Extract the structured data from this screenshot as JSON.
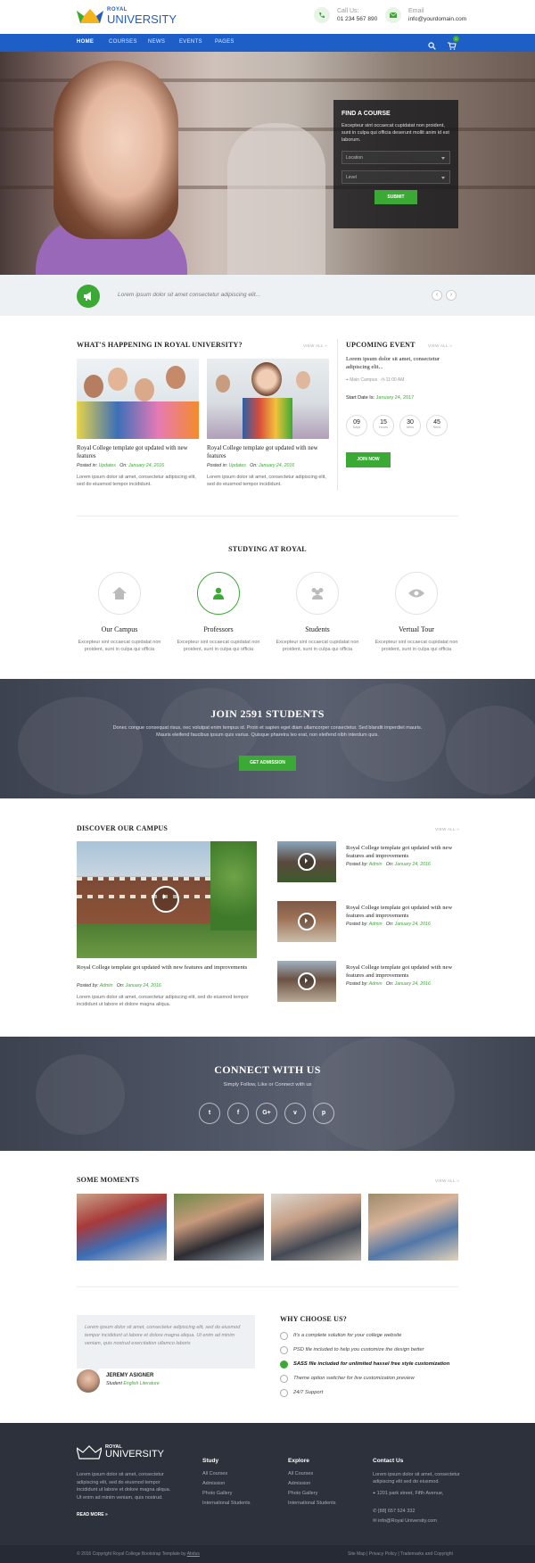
{
  "brand": {
    "line1": "ROYAL",
    "line2": "UNIVERSITY"
  },
  "contact": {
    "call_label": "Call Us:",
    "call_value": "01 234 567 890",
    "email_label": "Email",
    "email_value": "info@yourdomain.com"
  },
  "nav": {
    "items": [
      "HOME",
      "COURSES",
      "NEWS",
      "EVENTS",
      "PAGES"
    ],
    "cart_count": "0"
  },
  "course_finder": {
    "title": "FIND A COURSE",
    "text": "Excepteur sint occaecat cupidatat non proident, sunt in culpa qui officia deserunt mollit anim id est laborum.",
    "location_placeholder": "Location",
    "level_placeholder": "Level",
    "submit": "SUBMIT"
  },
  "ticker": {
    "text": "Lorem ipsum dolor sit amet consectetur adipiscing elit..."
  },
  "happening": {
    "title": "WHAT'S HAPPENING IN ROYAL UNIVERSITY?",
    "view_all": "VIEW ALL »",
    "cards": [
      {
        "title": "Royal College template got updated with new features",
        "posted_label": "Posted in:",
        "category": "Updates",
        "on_label": "On:",
        "date": "January 24, 2016",
        "desc": "Lorem ipsum dolor sit amet, consectetur adipiscing elit, sed do eiusmod tempor incididunt."
      },
      {
        "title": "Royal College template got updated with new features",
        "posted_label": "Posted in:",
        "category": "Updates",
        "on_label": "On:",
        "date": "January 24, 2016",
        "desc": "Lorem ipsum dolor sit amet, consectetur adipiscing elit, sed do eiusmod tempor incididunt."
      }
    ]
  },
  "event": {
    "title": "UPCOMING EVENT",
    "view_all": "VIEW ALL »",
    "name": "Lorem ipsum dolor sit amet, consectetur adipiscing elit...",
    "place": "Main Campus",
    "time": "11:00 AM",
    "start_label": "Start Date Is:",
    "start_date": "January 24, 2017",
    "countdown": [
      {
        "n": "09",
        "u": "Days"
      },
      {
        "n": "15",
        "u": "Hours"
      },
      {
        "n": "30",
        "u": "Mins"
      },
      {
        "n": "45",
        "u": "Secs"
      }
    ],
    "join": "JOIN NOW"
  },
  "studying": {
    "title": "STUDYING AT ROYAL",
    "items": [
      {
        "title": "Our Campus",
        "desc": "Excepteur sint occaecat cupidatat non proident, sunt in culpa qui officia"
      },
      {
        "title": "Professors",
        "desc": "Excepteur sint occaecat cupidatat non proident, sunt in culpa qui officia"
      },
      {
        "title": "Students",
        "desc": "Excepteur sint occaecat cupidatat non proident, sunt in culpa qui officia"
      },
      {
        "title": "Vertual Tour",
        "desc": "Excepteur sint occaecat cupidatat non proident, sunt in culpa qui officia"
      }
    ]
  },
  "join": {
    "title": "JOIN 2591 STUDENTS",
    "text": "Donec congue consequat risus, nec volutpat enim tempus id. Proin et sapien eget diam ullamcorper consectetur. Sed blandit imperdiet mauris. Mauris eleifend faucibus ipsum quis varius. Quisque pharetra leo erat, non eleifend nibh interdum quis.",
    "button": "GET ADMISSION"
  },
  "campus": {
    "title": "DISCOVER OUR CAMPUS",
    "view_all": "VIEW ALL »",
    "main": {
      "title": "Royal College template got updated with new features and improvements",
      "posted_label": "Posted by:",
      "author": "Admin",
      "on_label": "On:",
      "date": "January 24, 2016",
      "desc": "Lorem ipsum dolor sit amet, consectetur adipiscing elit, sed do eiusmod tempor incididunt ut labore et dolore magna aliqua."
    },
    "side": [
      {
        "title": "Royal College template got updated with new features and improvements",
        "posted_label": "Posted by:",
        "author": "Admin",
        "on_label": "On:",
        "date": "January 24, 2016"
      },
      {
        "title": "Royal College template got updated with new features and improvements",
        "posted_label": "Posted by:",
        "author": "Admin",
        "on_label": "On:",
        "date": "January 24, 2016"
      },
      {
        "title": "Royal College template got updated with new features and improvements",
        "posted_label": "Posted by:",
        "author": "Admin",
        "on_label": "On:",
        "date": "January 24, 2016"
      }
    ]
  },
  "connect": {
    "title": "CONNECT WITH US",
    "subtitle": "Simply Follow, Like or Connect with us",
    "icons": [
      "twitter-icon",
      "facebook-icon",
      "google-plus-icon",
      "vimeo-icon",
      "pinterest-icon"
    ],
    "glyphs": [
      "t",
      "f",
      "G+",
      "v",
      "p"
    ]
  },
  "moments": {
    "title": "SOME MOMENTS",
    "view_all": "VIEW ALL »"
  },
  "testimonial": {
    "quote": "Lorem ipsum dolor sit amet, consectetur adipiscing elit, sed do eiusmod tempor incididunt ut labore et dolore magna aliqua. Ut enim ad minim veniam, quis nostrud exercitation ullamco laboris",
    "name": "JEREMY ASIGNER",
    "role_label": "Student",
    "role": "English Literature"
  },
  "why": {
    "title": "WHY CHOOSE US?",
    "items": [
      "It's a complete solution for your college website",
      "PSD file included to help you customize the design better",
      "SASS file included for unlimited hassel free style customization",
      "Theme option switcher for live customization preview",
      "24/7 Support"
    ]
  },
  "footer": {
    "about": "Lorem ipsum dolor sit amet, consectetur adipiscing elit, sed do eiusmod tempor incididunt ut labore et dolore magna aliqua. Ut enim ad minim veniam, quis nostrud.",
    "read_more": "READ MORE »",
    "study": {
      "title": "Study",
      "links": [
        "All Courses",
        "Admission",
        "Photo Gallery",
        "International Students"
      ]
    },
    "explore": {
      "title": "Explore",
      "links": [
        "All Courses",
        "Admission",
        "Photo Gallery",
        "International Students"
      ]
    },
    "contact": {
      "title": "Contact Us",
      "text": "Lorem ipsum dolor sit amet, consectetur adipiscing elit sed do eiusmod.",
      "address": "1201 park street, Fifth Avenue,",
      "phone": "[88] 657 524 332",
      "email": "info@Royal University.com"
    },
    "copyright": "© 2016 Copyright Royal College Bootstrap Template by",
    "copyright_link": "Abdus",
    "links": "Site Map | Privacy Policy | Trademarks and Copyright"
  },
  "colors": {
    "primary": "#1e5fc7",
    "accent": "#3aaa35",
    "dark": "#2c313c"
  }
}
